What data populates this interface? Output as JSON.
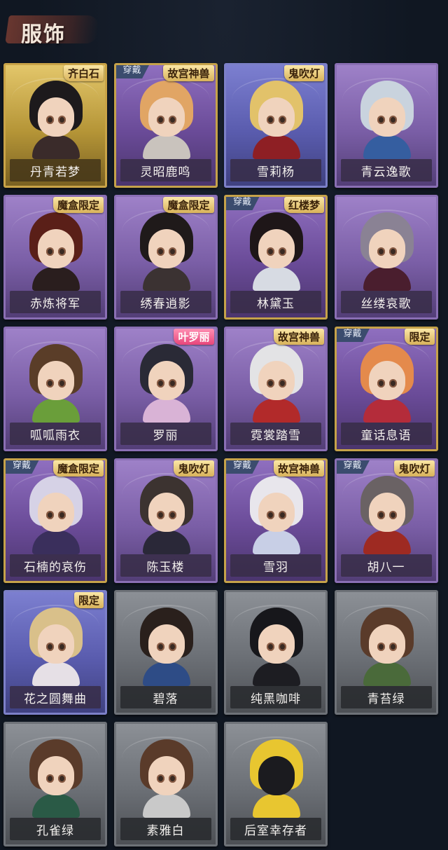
{
  "header": {
    "title": "服饰"
  },
  "colors": {
    "gold": "#c9a347",
    "purple": "#7a5ea6",
    "blue": "#5a5cae",
    "grey": "#6b6f75",
    "badge": "#3b4c6e"
  },
  "cards": [
    {
      "name": "丹青若梦",
      "tier": "gold",
      "badge": "",
      "tag": "齐白石",
      "hair": "#1d1a1c",
      "outfit": "#3a2b2a",
      "wearing": false
    },
    {
      "name": "灵昭鹿鸣",
      "tier": "purple-gold",
      "badge": "穿戴",
      "tag": "故宫神兽",
      "hair": "#e1a564",
      "outfit": "#c9c3bd",
      "wearing": true
    },
    {
      "name": "雪莉杨",
      "tier": "blue",
      "badge": "",
      "tag": "鬼吹灯",
      "hair": "#e2c26a",
      "outfit": "#8e1f24",
      "wearing": false
    },
    {
      "name": "青云逸歌",
      "tier": "purple",
      "badge": "",
      "tag": "",
      "hair": "#c9d3de",
      "outfit": "#355ea0",
      "wearing": false
    },
    {
      "name": "赤炼将军",
      "tier": "purple",
      "badge": "",
      "tag": "魔盒限定",
      "hair": "#5a1f18",
      "outfit": "#2a1e1e",
      "wearing": false
    },
    {
      "name": "绣春逍影",
      "tier": "purple",
      "badge": "",
      "tag": "魔盒限定",
      "hair": "#1f1a1a",
      "outfit": "#3b3232",
      "wearing": false
    },
    {
      "name": "林黛玉",
      "tier": "purple-gold",
      "badge": "穿戴",
      "tag": "红楼梦",
      "hair": "#1e1618",
      "outfit": "#d7dbe3",
      "wearing": true
    },
    {
      "name": "丝缕哀歌",
      "tier": "purple",
      "badge": "",
      "tag": "",
      "hair": "#8a8294",
      "outfit": "#4a1e2e",
      "wearing": false
    },
    {
      "name": "呱呱雨衣",
      "tier": "purple",
      "badge": "",
      "tag": "",
      "hair": "#5a3d28",
      "outfit": "#6a9e3a",
      "wearing": false
    },
    {
      "name": "罗丽",
      "tier": "purple",
      "badge": "",
      "tag": "叶罗丽",
      "tagStyle": "pink",
      "hair": "#2a2a36",
      "outfit": "#d9b3d6",
      "wearing": false
    },
    {
      "name": "霓裳踏雪",
      "tier": "purple",
      "badge": "",
      "tag": "故宫神兽",
      "hair": "#e3e3e5",
      "outfit": "#b22a2a",
      "wearing": false
    },
    {
      "name": "童话息语",
      "tier": "purple-gold",
      "badge": "穿戴",
      "tag": "限定",
      "hair": "#e48a4c",
      "outfit": "#b42c3a",
      "wearing": true
    },
    {
      "name": "石楠的哀伤",
      "tier": "purple-gold",
      "badge": "穿戴",
      "tag": "魔盒限定",
      "hair": "#d6d2e6",
      "outfit": "#3a2f5c",
      "wearing": true
    },
    {
      "name": "陈玉楼",
      "tier": "purple",
      "badge": "",
      "tag": "鬼吹灯",
      "hair": "#3c3330",
      "outfit": "#2a2838",
      "wearing": false
    },
    {
      "name": "雪羽",
      "tier": "purple-gold",
      "badge": "穿戴",
      "tag": "故宫神兽",
      "hair": "#e8e6ec",
      "outfit": "#c8cfe6",
      "wearing": true
    },
    {
      "name": "胡八一",
      "tier": "purple",
      "badge": "穿戴",
      "tag": "鬼吹灯",
      "hair": "#6a6264",
      "outfit": "#9e2a22",
      "wearing": true
    },
    {
      "name": "花之圆舞曲",
      "tier": "blue",
      "badge": "",
      "tag": "限定",
      "hair": "#d9c08a",
      "outfit": "#e6e0e6",
      "wearing": false
    },
    {
      "name": "碧落",
      "tier": "grey",
      "badge": "",
      "tag": "",
      "hair": "#2a201c",
      "outfit": "#2e4c86",
      "wearing": false
    },
    {
      "name": "纯黑咖啡",
      "tier": "grey",
      "badge": "",
      "tag": "",
      "hair": "#17171b",
      "outfit": "#1d1d22",
      "wearing": false
    },
    {
      "name": "青苔绿",
      "tier": "grey",
      "badge": "",
      "tag": "",
      "hair": "#5a3b2a",
      "outfit": "#4a6a3a",
      "wearing": false
    },
    {
      "name": "孔雀绿",
      "tier": "grey",
      "badge": "",
      "tag": "",
      "hair": "#5a3b2a",
      "outfit": "#2a5a46",
      "wearing": false
    },
    {
      "name": "素雅白",
      "tier": "grey",
      "badge": "",
      "tag": "",
      "hair": "#5a3b2a",
      "outfit": "#c9c9c9",
      "wearing": false
    },
    {
      "name": "后室幸存者",
      "tier": "grey",
      "badge": "",
      "tag": "",
      "hair": "#e8c630",
      "outfit": "#e8c630",
      "wearing": false
    }
  ]
}
